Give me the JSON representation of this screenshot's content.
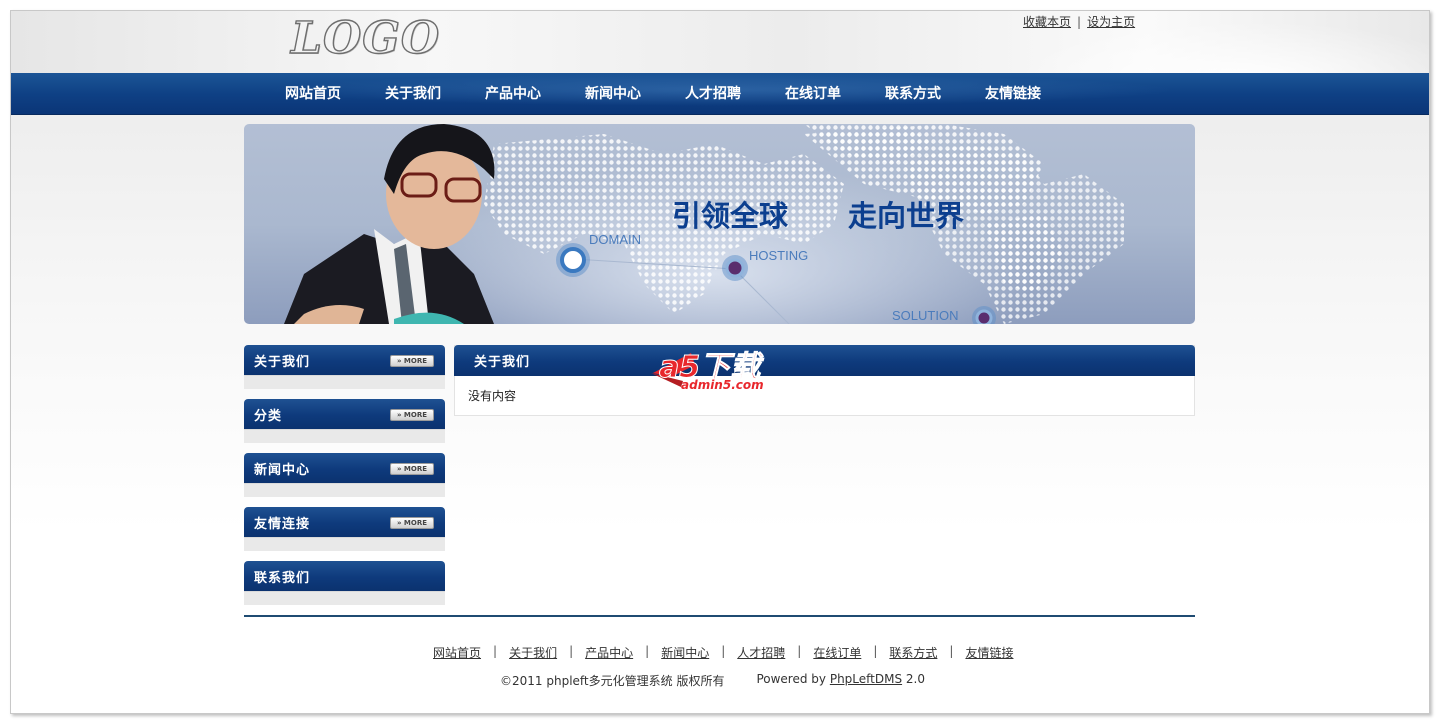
{
  "header": {
    "logo_text": "LOGO",
    "top_links": [
      "收藏本页",
      "设为主页"
    ],
    "top_link_separator": "|"
  },
  "nav": {
    "items": [
      "网站首页",
      "关于我们",
      "产品中心",
      "新闻中心",
      "人才招聘",
      "在线订单",
      "联系方式",
      "友情链接"
    ]
  },
  "banner": {
    "slogan_left": "引领全球",
    "slogan_right": "走向世界",
    "labels": [
      "DOMAIN",
      "HOSTING",
      "SOLUTION"
    ]
  },
  "sidebar": {
    "more_label": "» MORE",
    "boxes": [
      {
        "title": "关于我们",
        "has_more": true
      },
      {
        "title": "分类",
        "has_more": true
      },
      {
        "title": "新闻中心",
        "has_more": true
      },
      {
        "title": "友情连接",
        "has_more": true
      },
      {
        "title": "联系我们",
        "has_more": false
      }
    ]
  },
  "main": {
    "title": "关于我们",
    "content": "没有内容"
  },
  "watermark": {
    "brand": "a5下载",
    "site": "admin5.com"
  },
  "footer": {
    "links": [
      "网站首页",
      "关于我们",
      "产品中心",
      "新闻中心",
      "人才招聘",
      "在线订单",
      "联系方式",
      "友情链接"
    ],
    "separator": "|",
    "copyright": "©2011 phpleft多元化管理系统 版权所有",
    "powered_prefix": "Powered by ",
    "powered_link": "PhpLeftDMS",
    "powered_version": " 2.0"
  },
  "colors": {
    "nav_blue": "#0f4185",
    "box_header_blue": "#0e3a7c",
    "banner_text_blue": "#0c3f8f",
    "watermark_red": "#e8272c"
  }
}
